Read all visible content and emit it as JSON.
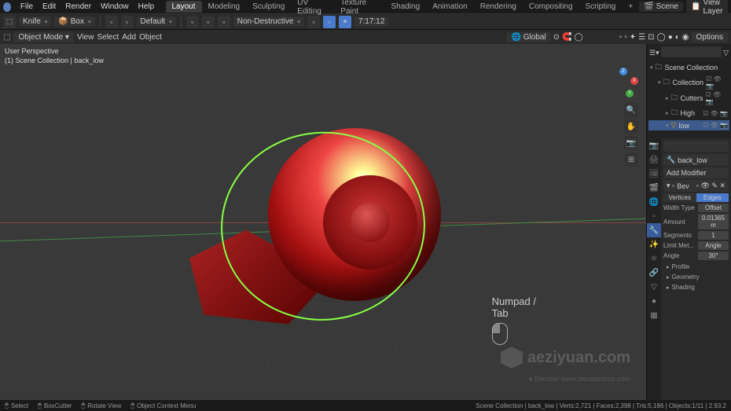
{
  "topmenu": {
    "items": [
      "File",
      "Edit",
      "Render",
      "Window",
      "Help"
    ],
    "workspaces": [
      "Layout",
      "Modeling",
      "Sculpting",
      "UV Editing",
      "Texture Paint",
      "Shading",
      "Animation",
      "Rendering",
      "Compositing",
      "Scripting"
    ],
    "active_workspace": "Layout",
    "scene_label": "Scene",
    "viewlayer_label": "View Layer"
  },
  "toolheader": {
    "tool": "Knife",
    "bool": "Box",
    "preset": "Default",
    "mode_label": "Non-Destructive",
    "time": "7:17:12"
  },
  "vpheader": {
    "mode": "Object Mode",
    "menus": [
      "View",
      "Select",
      "Add",
      "Object"
    ],
    "orientation": "Global",
    "options": "Options"
  },
  "viewport": {
    "info_line1": "User Perspective",
    "info_line2": "(1) Scene Collection | back_low",
    "keypress1": "Numpad /",
    "keypress2": "Tab",
    "watermark": "aeziyuan.com",
    "watermark2": "www.blenderbros.com"
  },
  "outliner": {
    "root": "Scene Collection",
    "items": [
      {
        "name": "Collection",
        "indent": 1
      },
      {
        "name": "Cutters",
        "indent": 2
      },
      {
        "name": "High",
        "indent": 2
      },
      {
        "name": "low",
        "indent": 2,
        "sel": true
      }
    ]
  },
  "properties": {
    "search_placeholder": "",
    "object_name": "back_low",
    "add_modifier": "Add Modifier",
    "modifier_name": "Bev",
    "vert_edge": {
      "vertices": "Vertices",
      "edges": "Edges"
    },
    "width_type_label": "Width Type",
    "width_type_value": "Offset",
    "amount_label": "Amount",
    "amount_value": "0.01365 m",
    "segments_label": "Segments",
    "segments_value": "1",
    "limit_label": "Limit Met...",
    "limit_value": "Angle",
    "angle_label": "Angle",
    "angle_value": "30°",
    "sections": [
      "Profile",
      "Geometry",
      "Shading"
    ]
  },
  "statusbar": {
    "left": [
      {
        "icon": "🖱",
        "text": "Select"
      },
      {
        "icon": "🖱",
        "text": "BoxCutter"
      },
      {
        "icon": "🖱",
        "text": "Rotate View"
      },
      {
        "icon": "🖱",
        "text": "Object Context Menu"
      }
    ],
    "right": "Scene Collection | back_low | Verts:2,721 | Faces:2,398 | Tris:5,186 | Objects:1/11 | 2.93.2"
  }
}
